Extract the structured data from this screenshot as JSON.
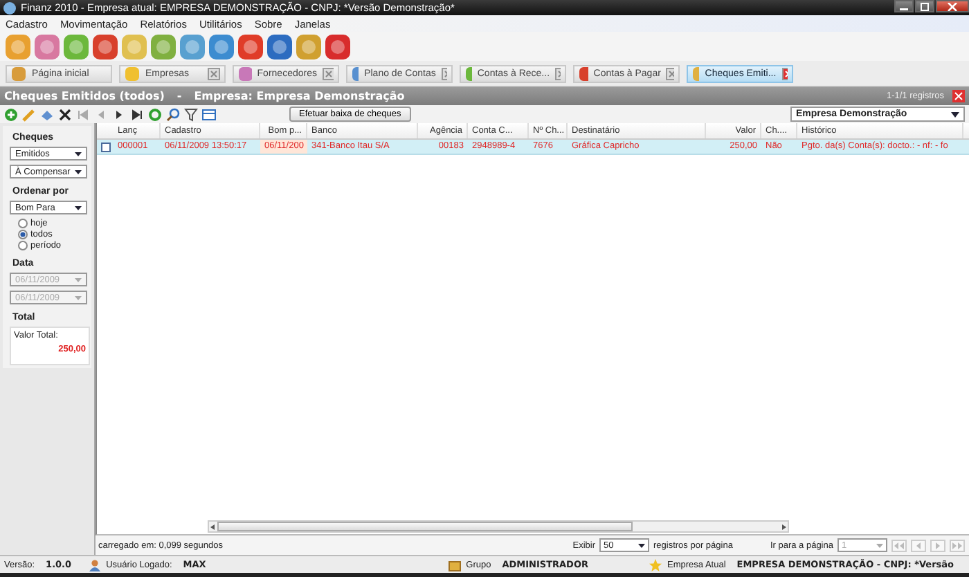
{
  "window": {
    "title": "Finanz 2010 - Empresa atual: EMPRESA DEMONSTRAÇÃO - CNPJ: *Versão Demonstração*"
  },
  "menu": [
    "Cadastro",
    "Movimentação",
    "Relatórios",
    "Utilitários",
    "Sobre",
    "Janelas"
  ],
  "tabs": [
    {
      "label": "Página inicial",
      "selected": false,
      "closable": false
    },
    {
      "label": "Empresas",
      "selected": false,
      "closable": true
    },
    {
      "label": "Fornecedores",
      "selected": false,
      "closable": true
    },
    {
      "label": "Plano de Contas",
      "selected": false,
      "closable": true
    },
    {
      "label": "Contas à Rece...",
      "selected": false,
      "closable": true
    },
    {
      "label": "Contas à Pagar",
      "selected": false,
      "closable": true
    },
    {
      "label": "Cheques Emiti...",
      "selected": true,
      "closable": true
    }
  ],
  "header": {
    "title": "Cheques Emitidos (todos)",
    "separator": "-",
    "company": "Empresa: Empresa Demonstração",
    "records": "1-1/1 registros"
  },
  "action_button": "Efetuar baixa de cheques",
  "company_select": "Empresa Demonstração",
  "sidebar": {
    "cheques_heading": "Cheques",
    "type_select": "Emitidos",
    "status_select": "À Compensar",
    "order_heading": "Ordenar por",
    "order_select": "Bom Para",
    "periods": [
      {
        "label": "hoje",
        "selected": false
      },
      {
        "label": "todos",
        "selected": true
      },
      {
        "label": "período",
        "selected": false
      }
    ],
    "date_heading": "Data",
    "dates": [
      {
        "value": "06/11/2009",
        "disabled": true
      },
      {
        "value": "06/11/2009",
        "disabled": true
      }
    ],
    "total_heading": "Total",
    "total_label": "Valor Total:",
    "total_value": "250,00"
  },
  "table": {
    "columns": [
      "Lanç",
      "Cadastro",
      "Bom p...",
      "Banco",
      "Agência",
      "Conta C...",
      "Nº Ch...",
      "Destinatário",
      "Valor",
      "Ch....",
      "Histórico"
    ],
    "rows": [
      {
        "selected": true,
        "checked": false,
        "cells": [
          "000001",
          "06/11/2009 13:50:17",
          "06/11/200",
          "341-Banco Itau S/A",
          "00183",
          "2948989-4",
          "7676",
          "Gráfica Capricho",
          "250,00",
          "Não",
          "Pgto. da(s) Conta(s): docto.: - nf: - fo"
        ]
      }
    ]
  },
  "footer": {
    "load_time": "carregado em: 0,099 segundos",
    "show_label": "Exibir",
    "page_size": "50",
    "per_page_label": "registros por página",
    "goto_label": "Ir para a página",
    "page": "1"
  },
  "status_bar": {
    "version_label": "Versão:",
    "version": "1.0.0",
    "user_label": "Usuário Logado:",
    "user": "MAX",
    "group_label": "Grupo",
    "group": "ADMINISTRADOR",
    "company_label": "Empresa Atual",
    "company": "EMPRESA DEMONSTRAÇÃO - CNPJ: *Versão"
  }
}
